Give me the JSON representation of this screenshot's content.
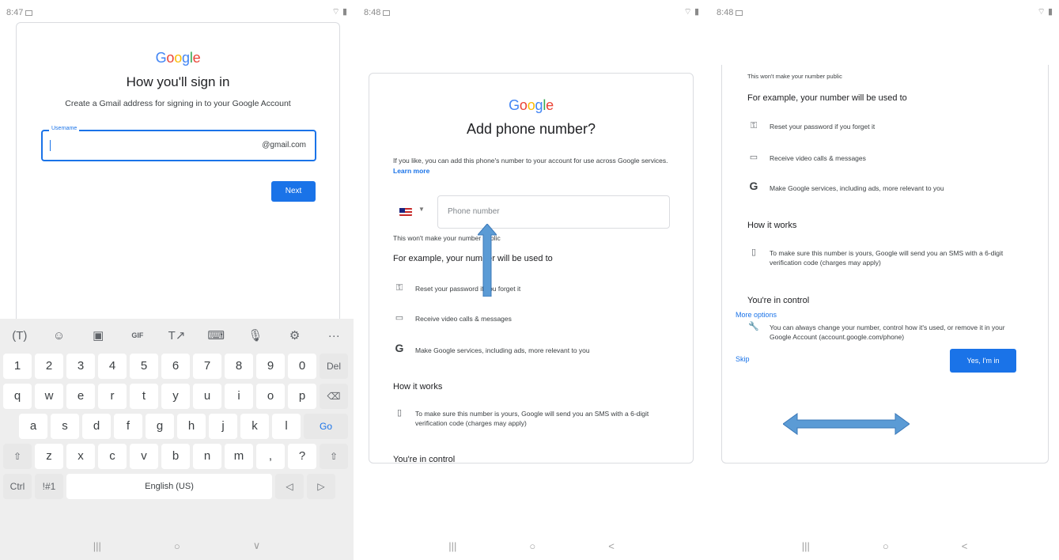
{
  "panel1": {
    "status_time": "8:47",
    "google_letters": [
      "G",
      "o",
      "o",
      "g",
      "l",
      "e"
    ],
    "title": "How you'll sign in",
    "subtitle": "Create a Gmail address for signing in to your Google Account",
    "username_label": "Username",
    "username_suffix": "@gmail.com",
    "next_label": "Next",
    "keyboard": {
      "toolbar": [
        "(T)",
        "☺",
        "▣",
        "GIF",
        "T↗",
        "⌨",
        "🎙",
        "⚙",
        "···"
      ],
      "rows": [
        [
          "1",
          "2",
          "3",
          "4",
          "5",
          "6",
          "7",
          "8",
          "9",
          "0",
          "Del"
        ],
        [
          "q",
          "w",
          "e",
          "r",
          "t",
          "y",
          "u",
          "i",
          "o",
          "p",
          "⌫"
        ],
        [
          "a",
          "s",
          "d",
          "f",
          "g",
          "h",
          "j",
          "k",
          "l",
          "Go"
        ],
        [
          "⇧",
          "z",
          "x",
          "c",
          "v",
          "b",
          "n",
          "m",
          ",",
          "?",
          "⇧"
        ],
        [
          "Ctrl",
          "!#1",
          "English (US)",
          "◁",
          "▷"
        ]
      ]
    },
    "nav": [
      "|||",
      "○",
      "∨"
    ]
  },
  "panel2": {
    "status_time": "8:48",
    "google_letters": [
      "G",
      "o",
      "o",
      "g",
      "l",
      "e"
    ],
    "title": "Add phone number?",
    "intro": "If you like, you can add this phone's number to your account for use across Google services.",
    "learn_more": "Learn more",
    "phone_placeholder": "Phone number",
    "not_public": "This won't make your number public",
    "example_heading": "For example, your number will be used to",
    "items": [
      {
        "icon": "key-icon",
        "glyph": "⚿",
        "text": "Reset your password if you forget it"
      },
      {
        "icon": "video-icon",
        "glyph": "▭",
        "text": "Receive video calls & messages"
      },
      {
        "icon": "google-g-icon",
        "glyph": "G",
        "text": "Make Google services, including ads, more relevant to you"
      }
    ],
    "how_heading": "How it works",
    "how_text": "To make sure this number is yours, Google will send you an SMS with a 6-digit verification code (charges may apply)",
    "control_heading": "You're in control",
    "nav": [
      "|||",
      "○",
      "<"
    ]
  },
  "panel3": {
    "status_time": "8:48",
    "not_public": "This won't make your number public",
    "example_heading": "For example, your number will be used to",
    "items": [
      {
        "icon": "key-icon",
        "glyph": "⚿",
        "text": "Reset your password if you forget it"
      },
      {
        "icon": "video-icon",
        "glyph": "▭",
        "text": "Receive video calls & messages"
      },
      {
        "icon": "google-g-icon",
        "glyph": "G",
        "text": "Make Google services, including ads, more relevant to you"
      }
    ],
    "how_heading": "How it works",
    "how_text": "To make sure this number is yours, Google will send you an SMS with a 6-digit verification code (charges may apply)",
    "control_heading": "You're in control",
    "control_text": "You can always change your number, control how it's used, or remove it in your Google Account (account.google.com/phone)",
    "more_options": "More options",
    "skip": "Skip",
    "yes_label": "Yes, I'm in",
    "nav": [
      "|||",
      "○",
      "<"
    ]
  },
  "colors": {
    "accent": "#1a73e8",
    "arrow": "#5b9bd5"
  }
}
